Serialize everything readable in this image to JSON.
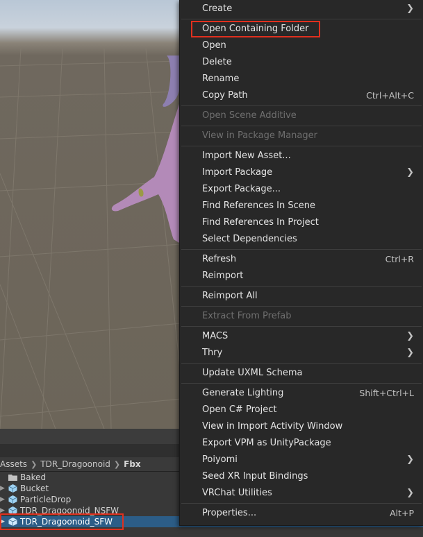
{
  "menu": {
    "items": [
      {
        "label": "Create",
        "shortcut": "",
        "submenu": true,
        "disabled": false
      },
      {
        "label": "Open Containing Folder",
        "shortcut": "",
        "submenu": false,
        "disabled": false,
        "highlighted": true
      },
      {
        "label": "Open",
        "shortcut": "",
        "submenu": false,
        "disabled": false
      },
      {
        "label": "Delete",
        "shortcut": "",
        "submenu": false,
        "disabled": false
      },
      {
        "label": "Rename",
        "shortcut": "",
        "submenu": false,
        "disabled": false
      },
      {
        "label": "Copy Path",
        "shortcut": "Ctrl+Alt+C",
        "submenu": false,
        "disabled": false
      },
      {
        "label": "Open Scene Additive",
        "shortcut": "",
        "submenu": false,
        "disabled": true
      },
      {
        "label": "View in Package Manager",
        "shortcut": "",
        "submenu": false,
        "disabled": true
      },
      {
        "label": "Import New Asset...",
        "shortcut": "",
        "submenu": false,
        "disabled": false
      },
      {
        "label": "Import Package",
        "shortcut": "",
        "submenu": true,
        "disabled": false
      },
      {
        "label": "Export Package...",
        "shortcut": "",
        "submenu": false,
        "disabled": false
      },
      {
        "label": "Find References In Scene",
        "shortcut": "",
        "submenu": false,
        "disabled": false
      },
      {
        "label": "Find References In Project",
        "shortcut": "",
        "submenu": false,
        "disabled": false
      },
      {
        "label": "Select Dependencies",
        "shortcut": "",
        "submenu": false,
        "disabled": false
      },
      {
        "label": "Refresh",
        "shortcut": "Ctrl+R",
        "submenu": false,
        "disabled": false
      },
      {
        "label": "Reimport",
        "shortcut": "",
        "submenu": false,
        "disabled": false
      },
      {
        "label": "Reimport All",
        "shortcut": "",
        "submenu": false,
        "disabled": false
      },
      {
        "label": "Extract From Prefab",
        "shortcut": "",
        "submenu": false,
        "disabled": true
      },
      {
        "label": "MACS",
        "shortcut": "",
        "submenu": true,
        "disabled": false
      },
      {
        "label": "Thry",
        "shortcut": "",
        "submenu": true,
        "disabled": false
      },
      {
        "label": "Update UXML Schema",
        "shortcut": "",
        "submenu": false,
        "disabled": false
      },
      {
        "label": "Generate Lighting",
        "shortcut": "Shift+Ctrl+L",
        "submenu": false,
        "disabled": false
      },
      {
        "label": "Open C# Project",
        "shortcut": "",
        "submenu": false,
        "disabled": false
      },
      {
        "label": "View in Import Activity Window",
        "shortcut": "",
        "submenu": false,
        "disabled": false
      },
      {
        "label": "Export VPM as UnityPackage",
        "shortcut": "",
        "submenu": false,
        "disabled": false
      },
      {
        "label": "Poiyomi",
        "shortcut": "",
        "submenu": true,
        "disabled": false
      },
      {
        "label": "Seed XR Input Bindings",
        "shortcut": "",
        "submenu": false,
        "disabled": false
      },
      {
        "label": "VRChat Utilities",
        "shortcut": "",
        "submenu": true,
        "disabled": false
      },
      {
        "label": "Properties...",
        "shortcut": "Alt+P",
        "submenu": false,
        "disabled": false
      }
    ]
  },
  "project": {
    "breadcrumb": [
      "Assets",
      "TDR_Dragoonoid",
      "Fbx"
    ],
    "files": [
      {
        "name": "Baked",
        "icon": "folder-icon",
        "selected": false
      },
      {
        "name": "Bucket",
        "icon": "model-icon",
        "selected": false
      },
      {
        "name": "ParticleDrop",
        "icon": "model-icon",
        "selected": false
      },
      {
        "name": "TDR_Dragoonoid_NSFW",
        "icon": "model-icon",
        "selected": false
      },
      {
        "name": "TDR_Dragoonoid_SFW",
        "icon": "model-icon",
        "selected": true
      }
    ]
  },
  "colors": {
    "highlight_box": "#e0301e",
    "selection": "#2c5d87",
    "menu_bg": "#282828"
  }
}
